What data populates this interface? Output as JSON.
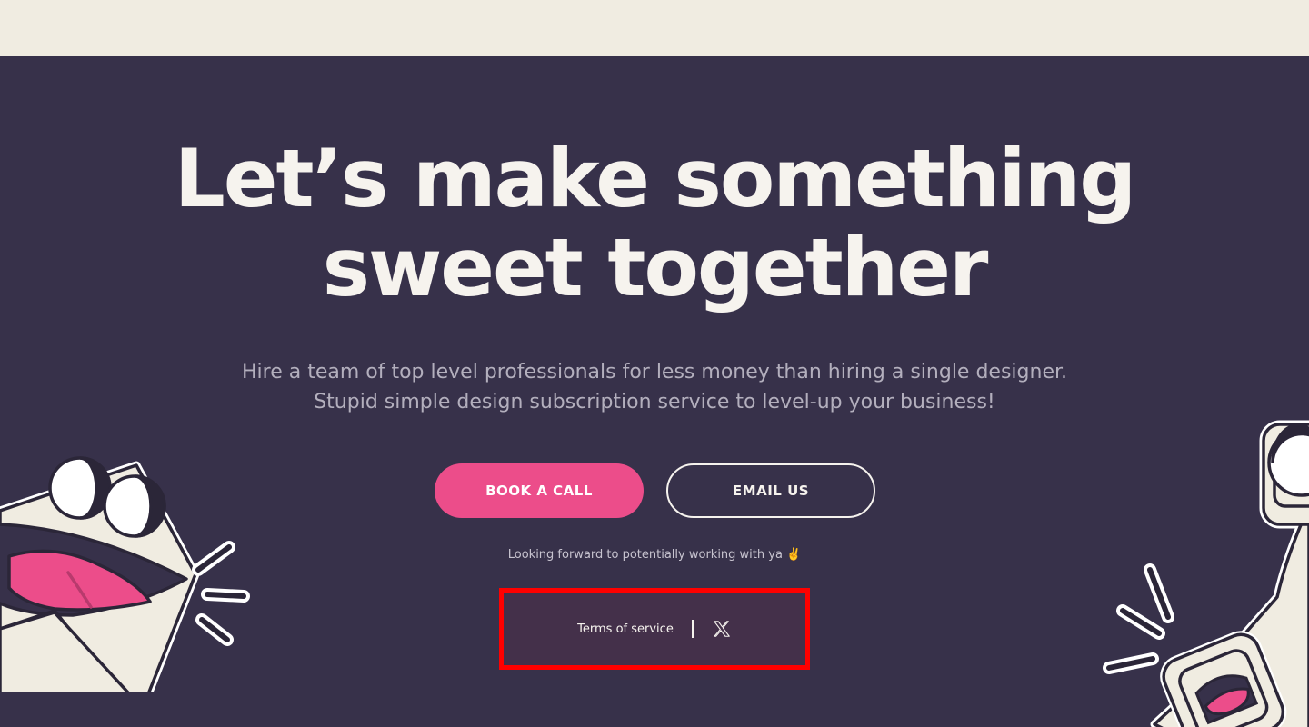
{
  "hero": {
    "headline_line1": "Let’s make something",
    "headline_line2": "sweet together",
    "subtext_line1": "Hire a team of top level professionals for less money than hiring a single designer.",
    "subtext_line2": "Stupid simple design subscription service to level-up your business!"
  },
  "buttons": {
    "book_label": "BOOK A CALL",
    "email_label": "EMAIL US"
  },
  "note": "Looking forward to potentially working with ya ✌️",
  "footer": {
    "tos_label": "Terms of service",
    "x_icon": "x-logo-icon"
  },
  "colors": {
    "background": "#37314a",
    "top_strip": "#f0ece1",
    "accent_pink": "#ec4d8a",
    "text_light": "#f6f3ee",
    "highlight_box": "#ff0000"
  }
}
